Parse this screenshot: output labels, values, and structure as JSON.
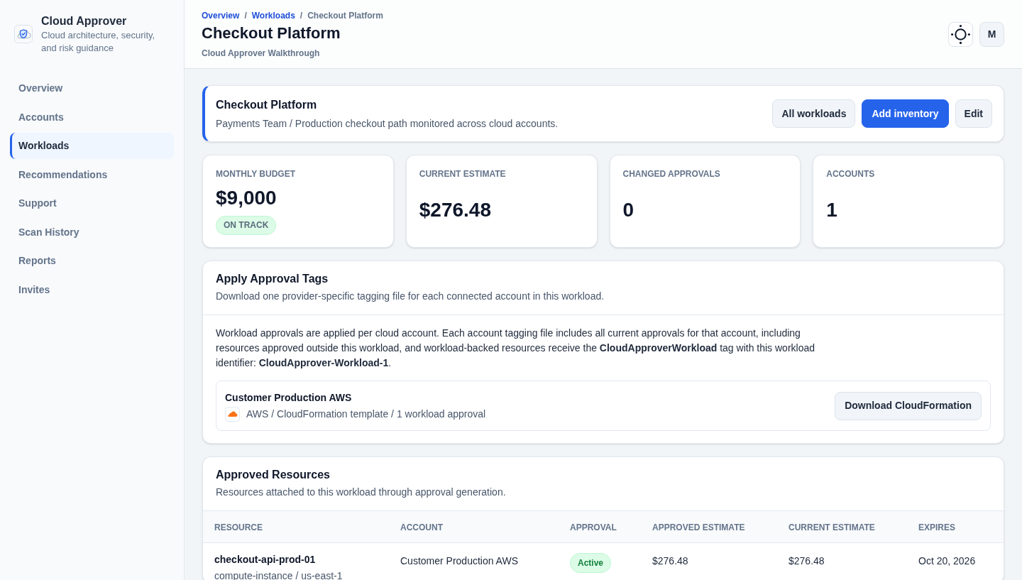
{
  "sidebar": {
    "brand": {
      "title": "Cloud Approver",
      "subtitle": "Cloud architecture, security, and risk guidance"
    },
    "items": [
      {
        "label": "Overview",
        "selected": false
      },
      {
        "label": "Accounts",
        "selected": false
      },
      {
        "label": "Workloads",
        "selected": true
      },
      {
        "label": "Recommendations",
        "selected": false
      },
      {
        "label": "Support",
        "selected": false
      },
      {
        "label": "Scan History",
        "selected": false
      },
      {
        "label": "Reports",
        "selected": false
      },
      {
        "label": "Invites",
        "selected": false
      }
    ]
  },
  "header": {
    "breadcrumbs": {
      "separator": "/",
      "items": [
        {
          "label": "Overview",
          "kind": "link"
        },
        {
          "label": "Workloads",
          "kind": "link"
        },
        {
          "label": "Checkout Platform",
          "kind": "current"
        }
      ]
    },
    "title": "Checkout Platform",
    "subtitle": "Cloud Approver Walkthrough",
    "avatar": "M"
  },
  "workload_card": {
    "title": "Checkout Platform",
    "description": "Payments Team / Production checkout path monitored across cloud accounts.",
    "buttons": [
      {
        "label": "All workloads",
        "kind": "secondary"
      },
      {
        "label": "Add inventory",
        "kind": "primary"
      },
      {
        "label": "Edit",
        "kind": "secondary"
      }
    ]
  },
  "stats": [
    {
      "label": "MONTHLY BUDGET",
      "value": "$9,000",
      "badge": "ON TRACK"
    },
    {
      "label": "CURRENT ESTIMATE",
      "value": "$276.48"
    },
    {
      "label": "CHANGED APPROVALS",
      "value": "0"
    },
    {
      "label": "ACCOUNTS",
      "value": "1"
    }
  ],
  "tags_panel": {
    "title": "Apply Approval Tags",
    "description": "Download one provider-specific tagging file for each connected account in this workload.",
    "body": "Workload approvals are applied per cloud account. Each account tagging file includes all current approvals for that account, including resources approved outside this workload, and workload-backed resources receive the **CloudApproverWorkload** tag with this workload identifier: **CloudApprover-Workload-1**.",
    "accounts": [
      {
        "name": "Customer Production AWS",
        "detail": "AWS / CloudFormation template / 1 workload approval",
        "action": "Download CloudFormation"
      }
    ]
  },
  "resources_panel": {
    "title": "Approved Resources",
    "description": "Resources attached to this workload through approval generation.",
    "table": {
      "columns": [
        "RESOURCE",
        "ACCOUNT",
        "APPROVAL",
        "APPROVED ESTIMATE",
        "CURRENT ESTIMATE",
        "EXPIRES"
      ],
      "rows": [
        {
          "resource": "checkout-api-prod-01",
          "resource_detail": "compute-instance / us-east-1",
          "account": "Customer Production AWS",
          "approval": "Active",
          "approved_estimate": "$276.48",
          "current_estimate": "$276.48",
          "expires": "Oct 20, 2026"
        }
      ]
    }
  }
}
